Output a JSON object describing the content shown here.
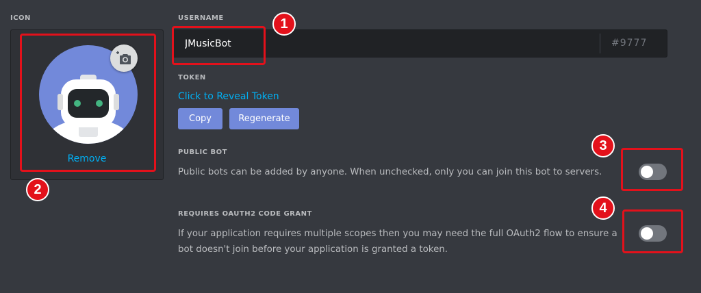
{
  "icon": {
    "label": "ICON",
    "remove_label": "Remove"
  },
  "username": {
    "label": "USERNAME",
    "value": "JMusicBot",
    "discriminator": "#9777"
  },
  "token": {
    "label": "TOKEN",
    "reveal_label": "Click to Reveal Token",
    "copy_label": "Copy",
    "regenerate_label": "Regenerate"
  },
  "public_bot": {
    "label": "PUBLIC BOT",
    "description": "Public bots can be added by anyone. When unchecked, only you can join this bot to servers.",
    "enabled": false
  },
  "oauth2": {
    "label": "REQUIRES OAUTH2 CODE GRANT",
    "description_line1": "If your application requires multiple scopes then you may need the full OAuth2 flow to ensure a",
    "description_line2": "bot doesn't join before your application is granted a token.",
    "enabled": false
  },
  "annotations": {
    "badge1": "1",
    "badge2": "2",
    "badge3": "3",
    "badge4": "4"
  },
  "colors": {
    "background": "#36393f",
    "accent": "#7289da",
    "link": "#00b0f4",
    "annotation": "#e3111b"
  }
}
